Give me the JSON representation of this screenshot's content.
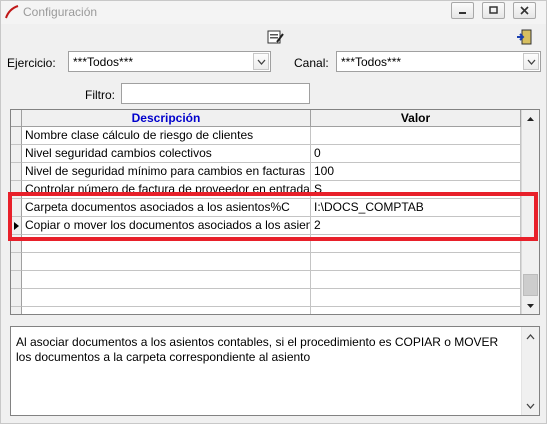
{
  "window": {
    "title": "Configuración"
  },
  "filters": {
    "ejercicio_label": "Ejercicio:",
    "ejercicio_value": "***Todos***",
    "canal_label": "Canal:",
    "canal_value": "***Todos***",
    "filtro_label": "Filtro:",
    "filtro_value": ""
  },
  "grid": {
    "columns": [
      "Descripción",
      "Valor"
    ],
    "rows": [
      {
        "desc": "Nombre clase cálculo de riesgo de clientes",
        "valor": ""
      },
      {
        "desc": "Nivel seguridad cambios colectivos",
        "valor": "0"
      },
      {
        "desc": "Nivel de seguridad mínimo para cambios en facturas",
        "valor": "100"
      },
      {
        "desc": "Controlar número de factura de proveedor en entrada",
        "valor": "S"
      },
      {
        "desc": "Carpeta documentos asociados a los asientos%C",
        "valor": "I:\\DOCS_COMPTAB"
      },
      {
        "desc": "Copiar o mover los documentos asociados a los asientos",
        "valor": "2"
      }
    ],
    "empty_rows": 5,
    "current_row_index": 5
  },
  "description_text": "Al asociar documentos a los asientos contables, si el procedimiento es COPIAR o MOVER los documentos a la carpeta correspondiente al asiento",
  "colors": {
    "highlight": "#e8202a",
    "header_text": "#0000cc"
  }
}
